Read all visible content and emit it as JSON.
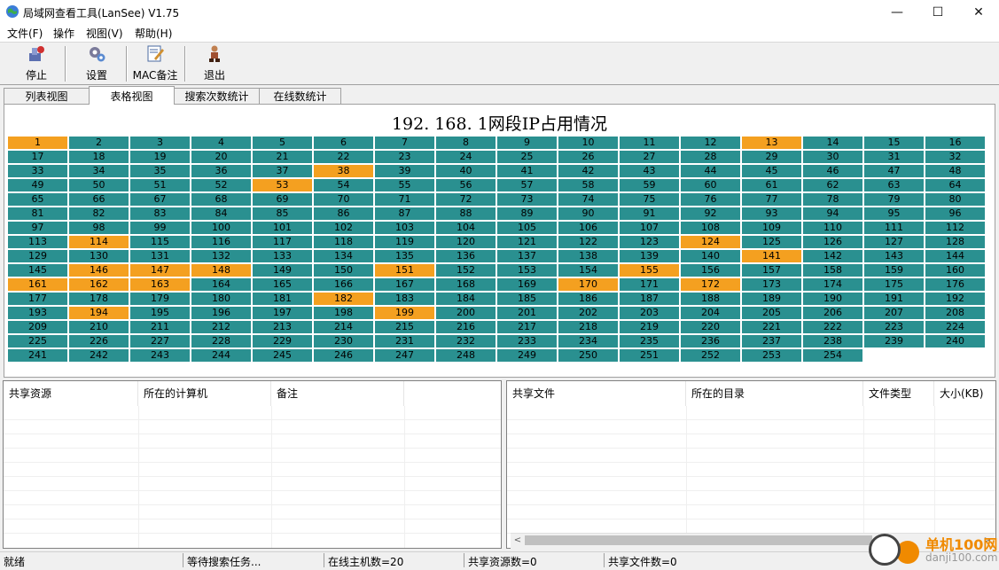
{
  "window": {
    "title": "局域网查看工具(LanSee) V1.75",
    "minimize": "—",
    "maximize": "☐",
    "close": "✕"
  },
  "menu": [
    "文件(F)",
    "操作",
    "视图(V)",
    "帮助(H)"
  ],
  "toolbar": [
    {
      "label": "停止",
      "icon": "stop-icon"
    },
    {
      "label": "设置",
      "icon": "settings-icon"
    },
    {
      "label": "MAC备注",
      "icon": "mac-note-icon"
    },
    {
      "label": "退出",
      "icon": "exit-icon"
    }
  ],
  "tabs": [
    {
      "label": "列表视图",
      "active": false
    },
    {
      "label": "表格视图",
      "active": true
    },
    {
      "label": "搜索次数统计",
      "active": false
    },
    {
      "label": "在线数统计",
      "active": false
    }
  ],
  "grid": {
    "title": "192. 168. 1网段IP占用情况",
    "count": 254,
    "used": [
      1,
      13,
      38,
      53,
      114,
      124,
      141,
      146,
      147,
      148,
      151,
      155,
      161,
      162,
      163,
      170,
      172,
      182,
      194,
      199
    ],
    "colors": {
      "free": "#2a9090",
      "used": "#f4a020"
    }
  },
  "shares_table": {
    "columns": [
      "共享资源",
      "所在的计算机",
      "备注",
      ""
    ]
  },
  "files_table": {
    "columns": [
      "共享文件",
      "所在的目录",
      "文件类型",
      "大小(KB)"
    ]
  },
  "scroll": {
    "left": "<",
    "right": ">"
  },
  "status": [
    "就绪",
    "等待搜索任务...",
    "在线主机数=20",
    "共享资源数=0",
    "共享文件数=0"
  ],
  "watermark": {
    "line1": "单机100网",
    "line2": "danji100.com"
  }
}
